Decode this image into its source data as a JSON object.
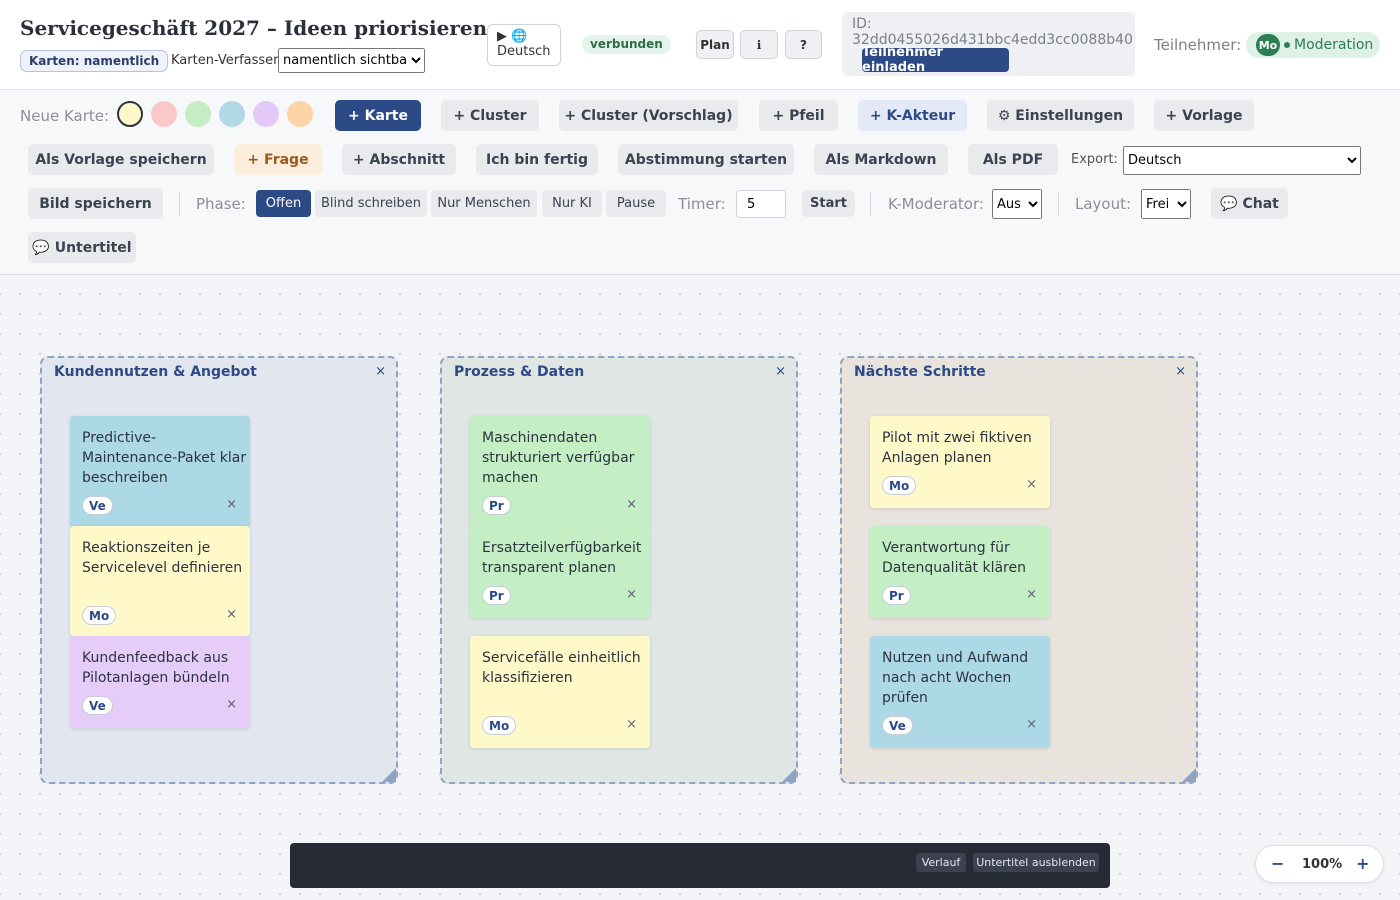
{
  "header": {
    "title": "Servicegeschäft 2027 – Ideen priorisieren",
    "badge_cards": "Karten: namentlich",
    "author_label": "Karten-Verfasser:",
    "author_select_value": "namentlich sichtbar",
    "language_button": "▶ 🌐 Deutsch",
    "connection_status": "verbunden",
    "plan_label": "Plan",
    "info_label": "ℹ",
    "help_label": "?",
    "session_id": "ID: 32dd0455026d431bbc4edd3cc0088b40",
    "invite_label": "Teilnehmer einladen",
    "participants_label": "Teilnehmer:",
    "participant": {
      "initials": "Mo",
      "role": "Moderation"
    }
  },
  "toolbar": {
    "new_card_label": "Neue Karte:",
    "swatches": [
      "#fff8c9",
      "#fbc8c8",
      "#c6ecc6",
      "#b3d9e6",
      "#e2c9f7",
      "#fdd4a8"
    ],
    "buttons": {
      "card": "+ Karte",
      "cluster": "+ Cluster",
      "cluster_suggest": "+ Cluster (Vorschlag)",
      "arrow": "+ Pfeil",
      "ai_actor": "+ K-Akteur",
      "settings": "⚙ Einstellungen",
      "template": "+ Vorlage",
      "save_template": "Als Vorlage speichern",
      "question": "+ Frage",
      "section": "+ Abschnitt",
      "done": "Ich bin fertig",
      "vote": "Abstimmung starten",
      "markdown": "Als Markdown",
      "pdf": "Als PDF",
      "save_image": "Bild speichern",
      "chat": "💬 Chat",
      "subtitles": "💬 Untertitel"
    },
    "export_label": "Export:",
    "export_value": "Deutsch",
    "phase_label": "Phase:",
    "phases": [
      "Offen",
      "Blind schreiben",
      "Nur Menschen",
      "Nur KI",
      "Pause"
    ],
    "timer_label": "Timer:",
    "timer_value": "5",
    "timer_start": "Start",
    "ai_moderator_label": "K-Moderator:",
    "ai_moderator_value": "Aus",
    "layout_label": "Layout:",
    "layout_value": "Frei"
  },
  "clusters": [
    {
      "title": "Kundennutzen & Angebot",
      "close": "×",
      "color": "#e2e6ef",
      "cards": [
        {
          "text": "Predictive-Maintenance-Paket klar beschreiben",
          "author": "Ve",
          "color": "#add8e6"
        },
        {
          "text": "Reaktionszeiten je Servicelevel definieren",
          "author": "Mo",
          "color": "#fff9c9"
        },
        {
          "text": "Kundenfeedback aus Pilotanlagen bündeln",
          "author": "Ve",
          "color": "#e5ccf9"
        }
      ]
    },
    {
      "title": "Prozess & Daten",
      "close": "×",
      "color": "#dfe6e4",
      "cards": [
        {
          "text": "Maschinendaten strukturiert verfügbar machen",
          "author": "Pr",
          "color": "#c4efc4"
        },
        {
          "text": "Ersatzteilverfügbarkeit transparent planen",
          "author": "Pr",
          "color": "#c4efc4"
        },
        {
          "text": "Servicefälle einheitlich klassifizieren",
          "author": "Mo",
          "color": "#fff9c9"
        }
      ]
    },
    {
      "title": "Nächste Schritte",
      "close": "×",
      "color": "#e9e3de",
      "cards": [
        {
          "text": "Pilot mit zwei fiktiven Anlagen planen",
          "author": "Mo",
          "color": "#fff9c9"
        },
        {
          "text": "Verantwortung für Datenqualität klären",
          "author": "Pr",
          "color": "#c4efc4"
        },
        {
          "text": "Nutzen und Aufwand nach acht Wochen prüfen",
          "author": "Ve",
          "color": "#add8e6"
        }
      ]
    }
  ],
  "subtitle_bar": {
    "history": "Verlauf",
    "hide": "Untertitel ausblenden"
  },
  "zoom": {
    "minus": "−",
    "level": "100%",
    "plus": "+"
  },
  "colors": {
    "accent": "#2c4a86",
    "status_green": "#2f7d55"
  }
}
